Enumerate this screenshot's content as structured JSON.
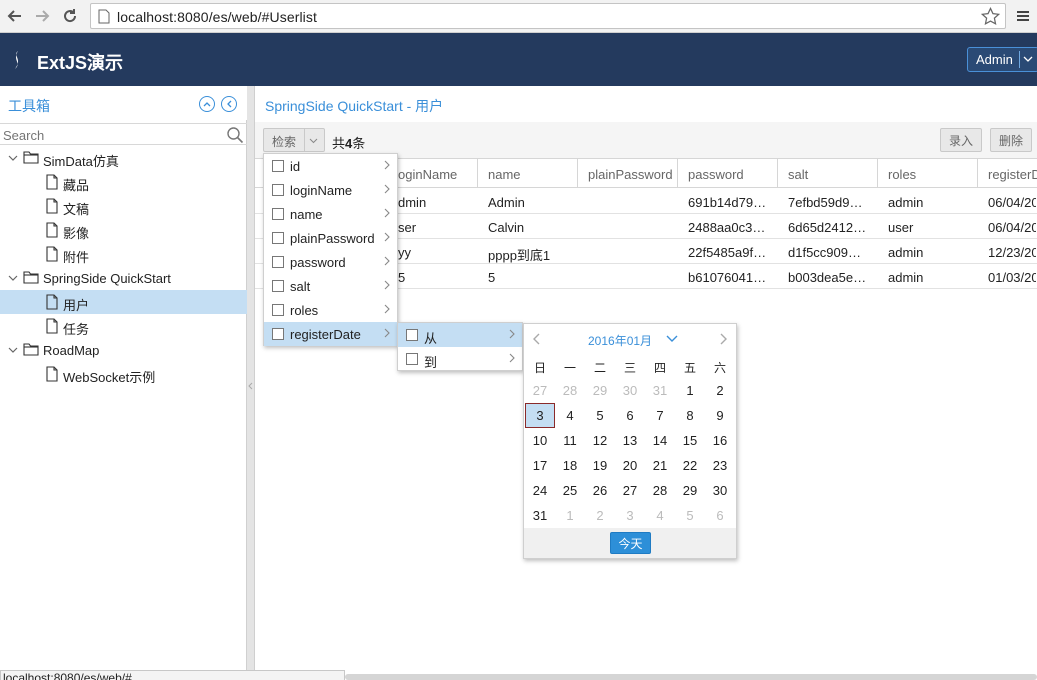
{
  "browser": {
    "url_host": "localhost",
    "url_rest": ":8080/es/web/#Userlist"
  },
  "header": {
    "app_title": "ExtJS演示",
    "user_button": "Admin"
  },
  "left": {
    "title": "工具箱",
    "search_placeholder": "Search",
    "tree": [
      {
        "label": "SimData仿真",
        "type": "folder"
      },
      {
        "label": "藏品",
        "type": "leaf"
      },
      {
        "label": "文稿",
        "type": "leaf"
      },
      {
        "label": "影像",
        "type": "leaf"
      },
      {
        "label": "附件",
        "type": "leaf"
      },
      {
        "label": "SpringSide QuickStart",
        "type": "folder"
      },
      {
        "label": "用户",
        "type": "leaf",
        "selected": true
      },
      {
        "label": "任务",
        "type": "leaf"
      },
      {
        "label": "RoadMap",
        "type": "folder"
      },
      {
        "label": "WebSocket示例",
        "type": "leaf"
      }
    ]
  },
  "main": {
    "title": "SpringSide QuickStart - 用户",
    "toolbar": {
      "search_button": "检索",
      "count_prefix": "共",
      "count_value": "4",
      "count_suffix": "条",
      "add_button": "录入",
      "delete_button": "删除"
    },
    "columns": [
      "loginName",
      "name",
      "plainPassword",
      "password",
      "salt",
      "roles",
      "registerDate"
    ],
    "column_visible_text": [
      "oginName",
      "name",
      "plainPassword",
      "password",
      "salt",
      "roles",
      "registerD"
    ],
    "rows": [
      [
        "dmin",
        "Admin",
        "",
        "691b14d79…",
        "7efbd59d9…",
        "admin",
        "06/04/20"
      ],
      [
        "ser",
        "Calvin",
        "",
        "2488aa0c3…",
        "6d65d2412…",
        "user",
        "06/04/20"
      ],
      [
        "yy",
        "pppp到底1",
        "",
        "22f5485a9f…",
        "d1f5cc909…",
        "admin",
        "12/23/20"
      ],
      [
        "5",
        "5",
        "",
        "b61076041…",
        "b003dea5e…",
        "admin",
        "01/03/20"
      ]
    ]
  },
  "filter_menu": {
    "items": [
      "id",
      "loginName",
      "name",
      "plainPassword",
      "password",
      "salt",
      "roles",
      "registerDate"
    ],
    "active_index": 7
  },
  "sub_menu": {
    "items": [
      "从",
      "到"
    ],
    "active_index": 0
  },
  "datepicker": {
    "month_label": "2016年01月",
    "day_names": [
      "日",
      "一",
      "二",
      "三",
      "四",
      "五",
      "六"
    ],
    "weeks": [
      [
        "27",
        "28",
        "29",
        "30",
        "31",
        "1",
        "2"
      ],
      [
        "3",
        "4",
        "5",
        "6",
        "7",
        "8",
        "9"
      ],
      [
        "10",
        "11",
        "12",
        "13",
        "14",
        "15",
        "16"
      ],
      [
        "17",
        "18",
        "19",
        "20",
        "21",
        "22",
        "23"
      ],
      [
        "24",
        "25",
        "26",
        "27",
        "28",
        "29",
        "30"
      ],
      [
        "31",
        "1",
        "2",
        "3",
        "4",
        "5",
        "6"
      ]
    ],
    "selected_day": "3",
    "today_button": "今天"
  },
  "status_tip": "localhost:8080/es/web/#",
  "colors": {
    "header_bg": "#243a5e",
    "accent": "#3a8fd9",
    "selected_bg": "#c4def3",
    "today_button": "#2d8fd8"
  }
}
